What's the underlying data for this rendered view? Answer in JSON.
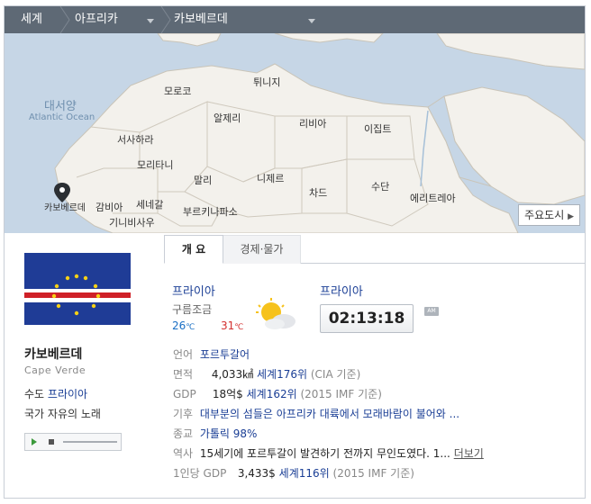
{
  "breadcrumb": {
    "items": [
      {
        "label": "세계"
      },
      {
        "label": "아프리카"
      },
      {
        "label": "카보베르데"
      }
    ]
  },
  "map": {
    "ocean": {
      "name_ko": "대서양",
      "name_en": "Atlantic Ocean"
    },
    "countries": [
      "튀니지",
      "모로코",
      "알제리",
      "리비아",
      "이집트",
      "서사하라",
      "모리타니",
      "말리",
      "니제르",
      "세네갈",
      "감비아",
      "기니비사우",
      "부르키나파소",
      "차드",
      "수단",
      "에리트레아"
    ],
    "marker_label": "카보베르데",
    "major_cities_button": "주요도시"
  },
  "country": {
    "name_ko": "카보베르데",
    "name_en": "Cape Verde",
    "capital_label": "수도",
    "capital": "프라이아",
    "anthem_label": "국가",
    "anthem": "자유의 노래",
    "flag_colors": {
      "blue": "#1f3c96",
      "white": "#ffffff",
      "red": "#cf2027",
      "star": "#f7d116"
    }
  },
  "tabs": [
    {
      "label": "개 요",
      "active": true
    },
    {
      "label": "경제·물가",
      "active": false
    }
  ],
  "weather": {
    "city": "프라이아",
    "condition": "구름조금",
    "low": "26",
    "high": "31",
    "unit": "℃",
    "icon": "partly-cloudy-icon",
    "low_color": "#1a6fc4",
    "high_color": "#d32f2f"
  },
  "time": {
    "city": "프라이아",
    "value": "02:13:18",
    "period": "AM"
  },
  "facts": {
    "language": {
      "label": "언어",
      "value": "포르투갈어"
    },
    "area": {
      "label": "면적",
      "value": "4,033㎢",
      "rank": "세계176위",
      "source": "(CIA 기준)"
    },
    "gdp": {
      "label": "GDP",
      "value": "18억$",
      "rank": "세계162위",
      "source": "(2015 IMF 기준)"
    },
    "climate": {
      "label": "기후",
      "value": "대부분의 섬들은 아프리카 대륙에서 모래바람이 불어와 ..."
    },
    "religion": {
      "label": "종교",
      "value": "가톨릭 98%"
    },
    "history": {
      "label": "역사",
      "value": "15세기에 포르투갈이 발견하기 전까지 무인도였다. 1...",
      "more": "더보기"
    },
    "gdp_per_capita": {
      "label": "1인당 GDP",
      "value": "3,433$",
      "rank": "세계116위",
      "source": "(2015 IMF 기준)"
    }
  }
}
